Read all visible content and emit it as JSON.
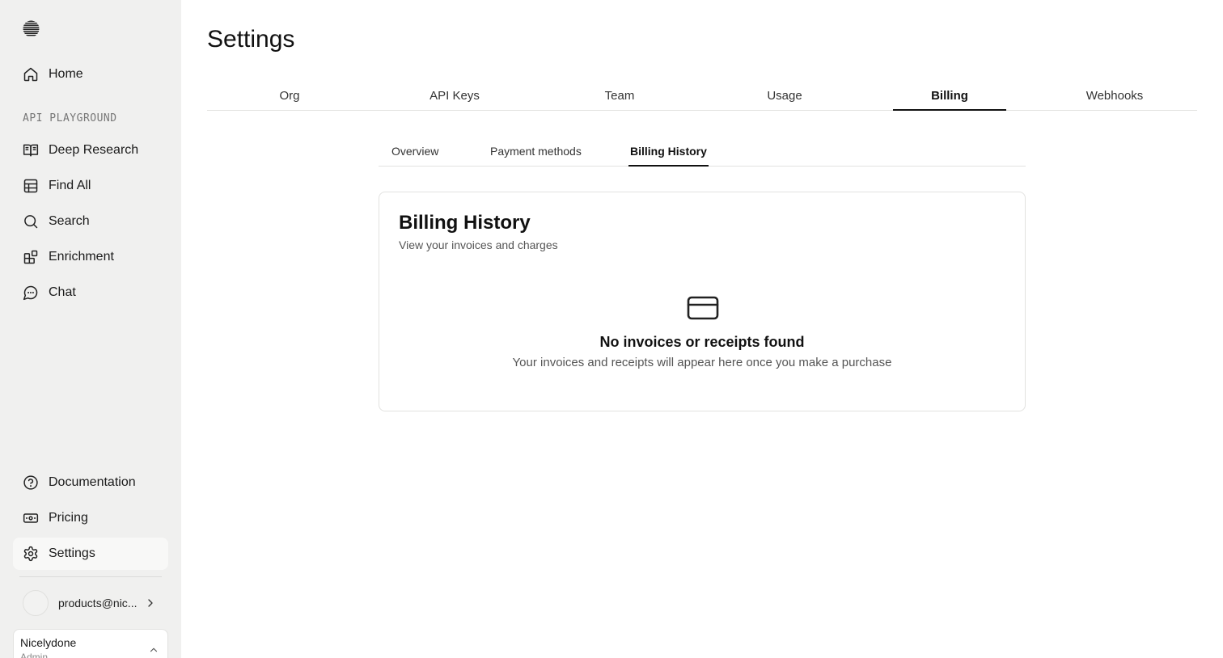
{
  "sidebar": {
    "logo_icon": "striped-globe-icon",
    "section_label": "API PLAYGROUND",
    "home": {
      "label": "Home",
      "icon": "home-icon"
    },
    "items": [
      {
        "label": "Deep Research",
        "icon": "book-open-icon"
      },
      {
        "label": "Find All",
        "icon": "table-icon"
      },
      {
        "label": "Search",
        "icon": "search-icon"
      },
      {
        "label": "Enrichment",
        "icon": "blocks-icon"
      },
      {
        "label": "Chat",
        "icon": "chat-icon"
      }
    ],
    "bottom_items": [
      {
        "label": "Documentation",
        "icon": "help-circle-icon"
      },
      {
        "label": "Pricing",
        "icon": "banknote-icon"
      },
      {
        "label": "Settings",
        "icon": "gear-icon"
      }
    ],
    "account": {
      "email": "products@nic..."
    },
    "org": {
      "name": "Nicelydone",
      "role": "Admin"
    }
  },
  "main": {
    "title": "Settings",
    "tabs": [
      "Org",
      "API Keys",
      "Team",
      "Usage",
      "Billing",
      "Webhooks"
    ],
    "active_tab": "Billing",
    "subtabs": [
      "Overview",
      "Payment methods",
      "Billing History"
    ],
    "active_subtab": "Billing History",
    "card": {
      "title": "Billing History",
      "subtitle": "View your invoices and charges",
      "empty_icon": "credit-card-icon",
      "empty_title": "No invoices or receipts found",
      "empty_desc": "Your invoices and receipts will appear here once you make a purchase"
    }
  },
  "colors": {
    "sidebar_bg": "#f0f0ef",
    "active_item_bg": "#f8f8f7",
    "border": "#e2e2e0",
    "text": "#111111"
  }
}
